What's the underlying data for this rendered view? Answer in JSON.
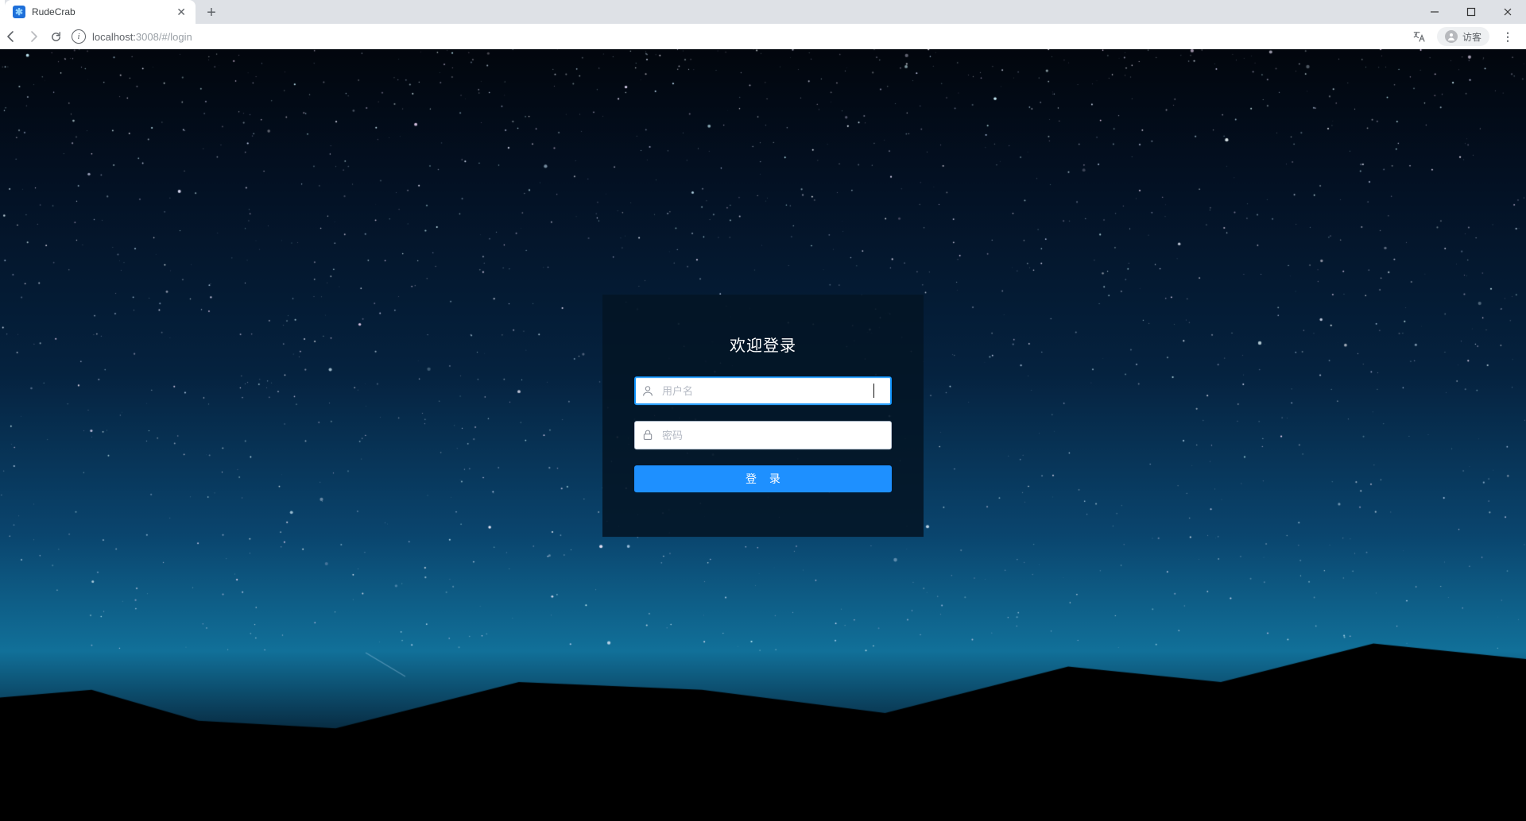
{
  "browser": {
    "tab_title": "RudeCrab",
    "url_host": "localhost:",
    "url_port": "3008",
    "url_path": "/#/login",
    "guest_label": "访客"
  },
  "login": {
    "title": "欢迎登录",
    "username_placeholder": "用户名",
    "password_placeholder": "密码",
    "submit_label": "登 录"
  },
  "colors": {
    "accent": "#1e90ff",
    "card_bg": "rgba(3,20,36,.88)"
  }
}
